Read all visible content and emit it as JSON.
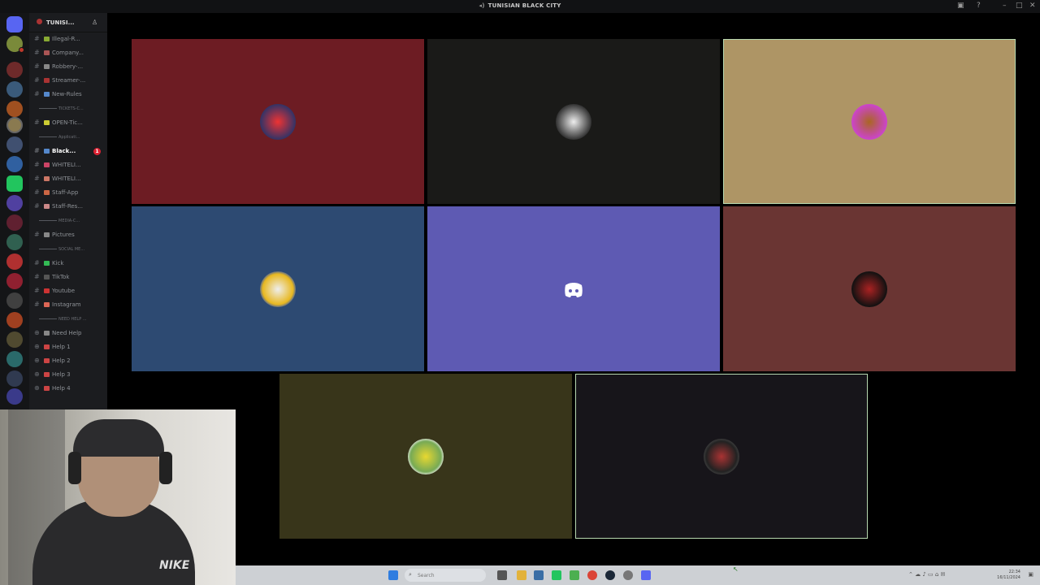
{
  "window": {
    "title": "TUNISIAN BLACK CITY"
  },
  "server": {
    "name": "TUNISI..."
  },
  "channels": [
    {
      "label": "Illegal-R...",
      "type": "text"
    },
    {
      "label": "Company...",
      "type": "text"
    },
    {
      "label": "Robbery-...",
      "type": "text"
    },
    {
      "label": "Streamer-...",
      "type": "text"
    },
    {
      "label": "New-Rules",
      "type": "text"
    },
    {
      "label": "TICKETS-C...",
      "type": "category"
    },
    {
      "label": "OPEN-Tic...",
      "type": "text"
    },
    {
      "label": "Applicati...",
      "type": "category"
    },
    {
      "label": "Black...",
      "type": "text",
      "active": true,
      "badge": "1"
    },
    {
      "label": "WHITELI...",
      "type": "text"
    },
    {
      "label": "WHITELI...",
      "type": "text"
    },
    {
      "label": "Staff-App",
      "type": "text"
    },
    {
      "label": "Staff-Res...",
      "type": "text"
    },
    {
      "label": "MEDIA-C...",
      "type": "category"
    },
    {
      "label": "Pictures",
      "type": "text"
    },
    {
      "label": "SOCIAL ME...",
      "type": "category"
    },
    {
      "label": "Kick",
      "type": "text"
    },
    {
      "label": "TikTok",
      "type": "text"
    },
    {
      "label": "Youtube",
      "type": "text"
    },
    {
      "label": "Instagram",
      "type": "text"
    },
    {
      "label": "NEED HELP ...",
      "type": "category"
    },
    {
      "label": "Need Help",
      "type": "voice"
    },
    {
      "label": "Help 1",
      "type": "voice"
    },
    {
      "label": "Help 2",
      "type": "voice"
    },
    {
      "label": "Help 3",
      "type": "voice"
    },
    {
      "label": "Help 4",
      "type": "voice"
    }
  ],
  "tiles": [
    {
      "bg": "#6d1c23",
      "avatar": "red-logo-avatar",
      "speaking": false
    },
    {
      "bg": "#1a1a18",
      "avatar": "mask-avatar",
      "speaking": false
    },
    {
      "bg": "#ae9565",
      "avatar": "colorful-avatar",
      "speaking": true
    },
    {
      "bg": "#2d4a72",
      "avatar": "blue-yellow-avatar",
      "speaking": false
    },
    {
      "bg": "#5e5ab3",
      "avatar": "discord-default-avatar",
      "speaking": false
    },
    {
      "bg": "#6a3533",
      "avatar": "dark-avatar",
      "speaking": false
    },
    {
      "bg": "#38351a",
      "avatar": "yellow-face-avatar",
      "speaking": false
    },
    {
      "bg": "#17151a",
      "avatar": "robot-avatar",
      "speaking": true
    }
  ],
  "taskbar": {
    "search_placeholder": "Search",
    "time": "22:34",
    "date": "16/11/2024"
  },
  "colors": {
    "accent": "#5865f2",
    "speaking_ring": "#b8d8b0"
  }
}
